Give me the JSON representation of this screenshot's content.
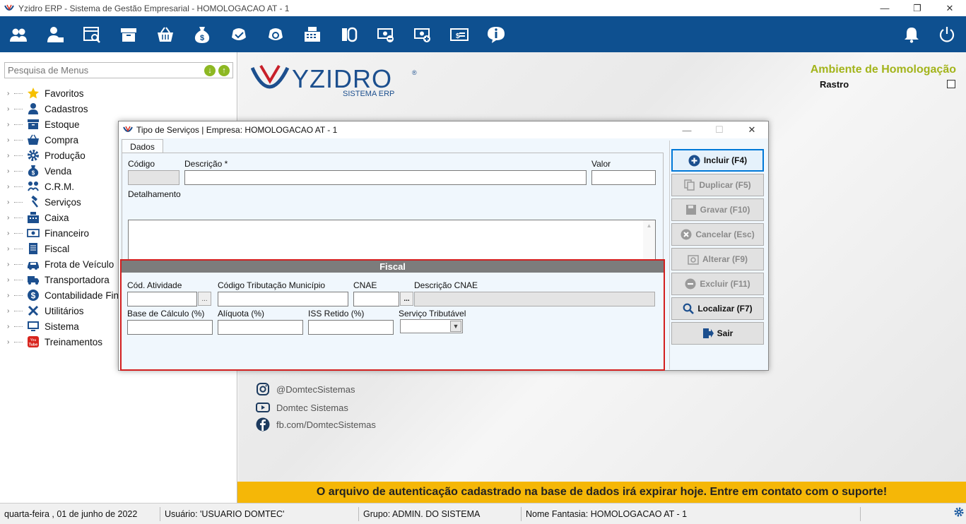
{
  "window": {
    "title": "Yzidro ERP - Sistema de Gestão Empresarial - HOMOLOGACAO AT - 1",
    "minimize": "—",
    "restore": "❐",
    "close": "✕"
  },
  "toolbar": {
    "icons": [
      "users-icon",
      "user-card-icon",
      "register-search-icon",
      "archive-box-icon",
      "basket-icon",
      "money-bag-icon",
      "nfe-icon",
      "nfse-icon",
      "cash-register-icon",
      "scanner-icon",
      "money-minus-icon",
      "money-plus-icon",
      "invoice-money-icon",
      "info-icon"
    ],
    "right_icons": [
      "bell-icon",
      "power-icon"
    ]
  },
  "sidebar": {
    "search_placeholder": "Pesquisa de Menus",
    "items": [
      {
        "label": "Favoritos",
        "icon": "star-icon"
      },
      {
        "label": "Cadastros",
        "icon": "user-icon"
      },
      {
        "label": "Estoque",
        "icon": "box-icon"
      },
      {
        "label": "Compra",
        "icon": "basket-icon"
      },
      {
        "label": "Produção",
        "icon": "gear-icon"
      },
      {
        "label": "Venda",
        "icon": "money-bag-icon"
      },
      {
        "label": "C.R.M.",
        "icon": "people-icon"
      },
      {
        "label": "Serviços",
        "icon": "hammer-icon"
      },
      {
        "label": "Caixa",
        "icon": "cash-register-icon"
      },
      {
        "label": "Financeiro",
        "icon": "bill-icon"
      },
      {
        "label": "Fiscal",
        "icon": "document-icon"
      },
      {
        "label": "Frota de Veículo",
        "icon": "car-icon"
      },
      {
        "label": "Transportadora",
        "icon": "truck-icon"
      },
      {
        "label": "Contabilidade Finan",
        "icon": "dollar-icon"
      },
      {
        "label": "Utilitários",
        "icon": "tools-icon"
      },
      {
        "label": "Sistema",
        "icon": "monitor-icon"
      },
      {
        "label": "Treinamentos",
        "icon": "youtube-icon"
      }
    ]
  },
  "main": {
    "logo_text": "YZIDRO",
    "logo_sub": "SISTEMA ERP",
    "logo_reg": "®",
    "environment": "Ambiente de Homologação",
    "rastro": "Rastro",
    "social": {
      "instagram": "@DomtecSistemas",
      "youtube": "Domtec Sistemas",
      "facebook": "fb.com/DomtecSistemas"
    },
    "banner": "O arquivo de autenticação cadastrado na base de dados irá expirar hoje. Entre em contato com o suporte!"
  },
  "dialog": {
    "title": "Tipo de Serviços | Empresa: HOMOLOGACAO AT - 1",
    "maximize": "☐",
    "tab": "Dados",
    "fields": {
      "codigo": {
        "label": "Código",
        "value": ""
      },
      "descricao": {
        "label": "Descrição *",
        "value": ""
      },
      "valor": {
        "label": "Valor",
        "value": ""
      },
      "detalhamento": {
        "label": "Detalhamento",
        "value": ""
      }
    },
    "fiscal": {
      "title": "Fiscal",
      "cod_atividade": "Cód. Atividade",
      "cod_trib_municipio": "Código Tributação Município",
      "cnae": "CNAE",
      "descricao_cnae": "Descrição CNAE",
      "base_calculo": "Base de Cálculo (%)",
      "aliquota": "Alíquota (%)",
      "iss_retido": "ISS Retido (%)",
      "servico_tributavel": "Serviço Tributável",
      "ellipsis": "...",
      "ellipsis_cnae": "..."
    },
    "actions": [
      {
        "label": "Incluir (F4)",
        "icon": "plus-circle-icon",
        "enabled": true
      },
      {
        "label": "Duplicar (F5)",
        "icon": "copy-icon",
        "enabled": false
      },
      {
        "label": "Gravar (F10)",
        "icon": "save-icon",
        "enabled": false
      },
      {
        "label": "Cancelar (Esc)",
        "icon": "cancel-icon",
        "enabled": false
      },
      {
        "label": "Alterar (F9)",
        "icon": "edit-icon",
        "enabled": false
      },
      {
        "label": "Excluir (F11)",
        "icon": "minus-circle-icon",
        "enabled": false
      },
      {
        "label": "Localizar (F7)",
        "icon": "search-icon",
        "enabled": true
      },
      {
        "label": "Sair",
        "icon": "exit-icon",
        "enabled": true
      }
    ]
  },
  "status": {
    "date": "quarta-feira , 01 de junho de 2022",
    "user": "Usuário: 'USUARIO DOMTEC'",
    "group": "Grupo: ADMIN. DO SISTEMA",
    "fantasy": "Nome Fantasia: HOMOLOGACAO AT - 1"
  },
  "colors": {
    "toolbar": "#0e5090",
    "banner": "#f5b707",
    "environment": "#a3b41b",
    "fiscal_border": "#d31f1f"
  }
}
